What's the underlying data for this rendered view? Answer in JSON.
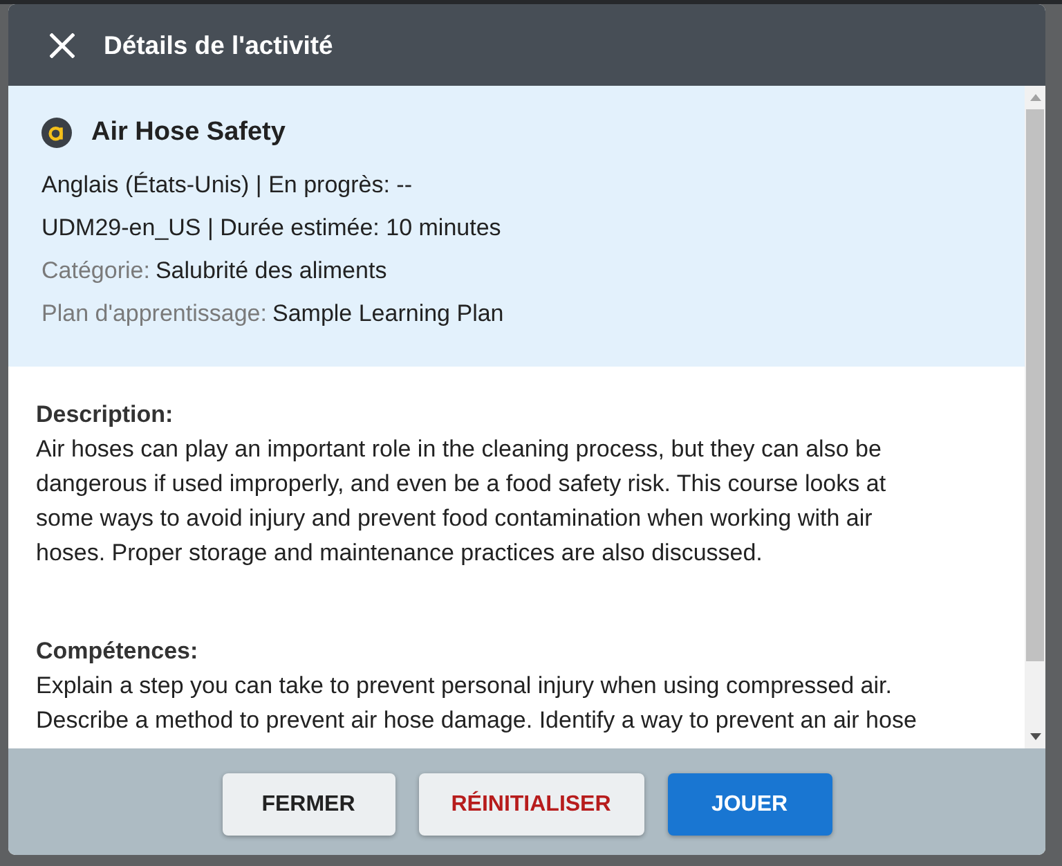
{
  "dialog": {
    "title": "Détails de l'activité"
  },
  "course": {
    "title": "Air Hose Safety",
    "lines": [
      "Anglais (États-Unis) | En progrès: --",
      "UDM29-en_US | Durée estimée: 10 minutes"
    ],
    "fields": [
      {
        "label": "Catégorie:",
        "value": "Salubrité des aliments"
      },
      {
        "label": "Plan d'apprentissage:",
        "value": "Sample Learning Plan"
      }
    ]
  },
  "sections": [
    {
      "heading": "Description:",
      "text": "Air hoses can play an important role in the cleaning process, but they can also be dangerous if used improperly, and even be a food safety risk. This course looks at some ways to avoid injury and prevent food contamination when working with air hoses. Proper storage and maintenance practices are also discussed."
    },
    {
      "heading": "Compétences:",
      "text": "Explain a step you can take to prevent personal injury when using compressed air. Describe a method to prevent air hose damage. Identify a way to prevent an air hose"
    }
  ],
  "buttons": [
    {
      "label": "FERMER",
      "kind": "secondary"
    },
    {
      "label": "RÉINITIALISER",
      "kind": "danger"
    },
    {
      "label": "JOUER",
      "kind": "primary"
    }
  ]
}
